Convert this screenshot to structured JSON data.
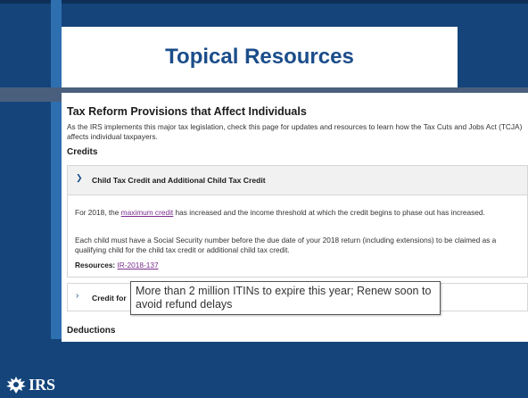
{
  "slide": {
    "title": "Topical Resources"
  },
  "page": {
    "heading": "Tax Reform Provisions that Affect Individuals",
    "intro": "As the IRS implements this major tax legislation, check this page for updates and resources to learn how the Tax Cuts and Jobs Act (TCJA) affects individual taxpayers.",
    "credits_heading": "Credits",
    "accordion1": {
      "title": "Child Tax Credit and Additional Child Tax Credit",
      "para1_before": "For 2018, the ",
      "para1_link": "maximum credit",
      "para1_after": " has increased and the income threshold at which the credit begins to phase out has increased.",
      "para2": "Each child must have a Social Security number before the due date of your 2018 return (including extensions) to be claimed as a qualifying child for the child tax credit or additional child tax credit.",
      "resources_label": "Resources: ",
      "resources_link": "IR-2018-137"
    },
    "accordion2": {
      "title": "Credit for"
    },
    "deductions_heading": "Deductions"
  },
  "tooltip": {
    "text": "More than 2 million ITINs to expire this year; Renew soon to avoid refund delays"
  },
  "footer": {
    "logo_text": "IRS"
  },
  "colors": {
    "background": "#14447a",
    "title_text": "#1b4d8a",
    "link": "#7a2d8e"
  }
}
